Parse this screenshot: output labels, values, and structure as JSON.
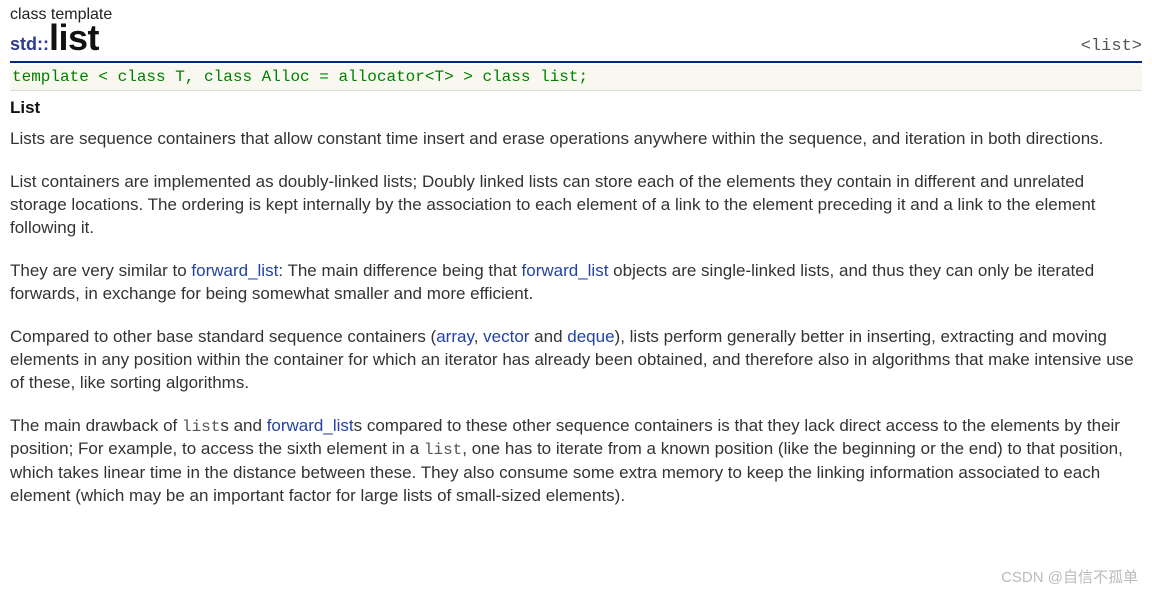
{
  "header": {
    "class_template_label": "class template",
    "namespace": "std::",
    "title": "list",
    "header_tag": "<list>"
  },
  "template_signature": "template < class T, class Alloc = allocator<T> > class list;",
  "section_title": "List",
  "paragraphs": {
    "p1": "Lists are sequence containers that allow constant time insert and erase operations anywhere within the sequence, and iteration in both directions.",
    "p2": "List containers are implemented as doubly-linked lists; Doubly linked lists can store each of the elements they contain in different and unrelated storage locations. The ordering is kept internally by the association to each element of a link to the element preceding it and a link to the element following it.",
    "p3_a": "They are very similar to ",
    "p3_link1": "forward_list",
    "p3_b": ": The main difference being that ",
    "p3_link2": "forward_list",
    "p3_c": " objects are single-linked lists, and thus they can only be iterated forwards, in exchange for being somewhat smaller and more efficient.",
    "p4_a": "Compared to other base standard sequence containers (",
    "p4_link1": "array",
    "p4_sep1": ", ",
    "p4_link2": "vector",
    "p4_sep2": " and ",
    "p4_link3": "deque",
    "p4_b": "), lists perform generally better in inserting, extracting and moving elements in any position within the container for which an iterator has already been obtained, and therefore also in algorithms that make intensive use of these, like sorting algorithms.",
    "p5_a": "The main drawback of ",
    "p5_code1": "list",
    "p5_b": "s and ",
    "p5_link1": "forward_list",
    "p5_c": "s compared to these other sequence containers is that they lack direct access to the elements by their position; For example, to access the sixth element in a ",
    "p5_code2": "list",
    "p5_d": ", one has to iterate from a known position (like the beginning or the end) to that position, which takes linear time in the distance between these. They also consume some extra memory to keep the linking information associated to each element (which may be an important factor for large lists of small-sized elements)."
  },
  "watermark": "CSDN @自信不孤单"
}
